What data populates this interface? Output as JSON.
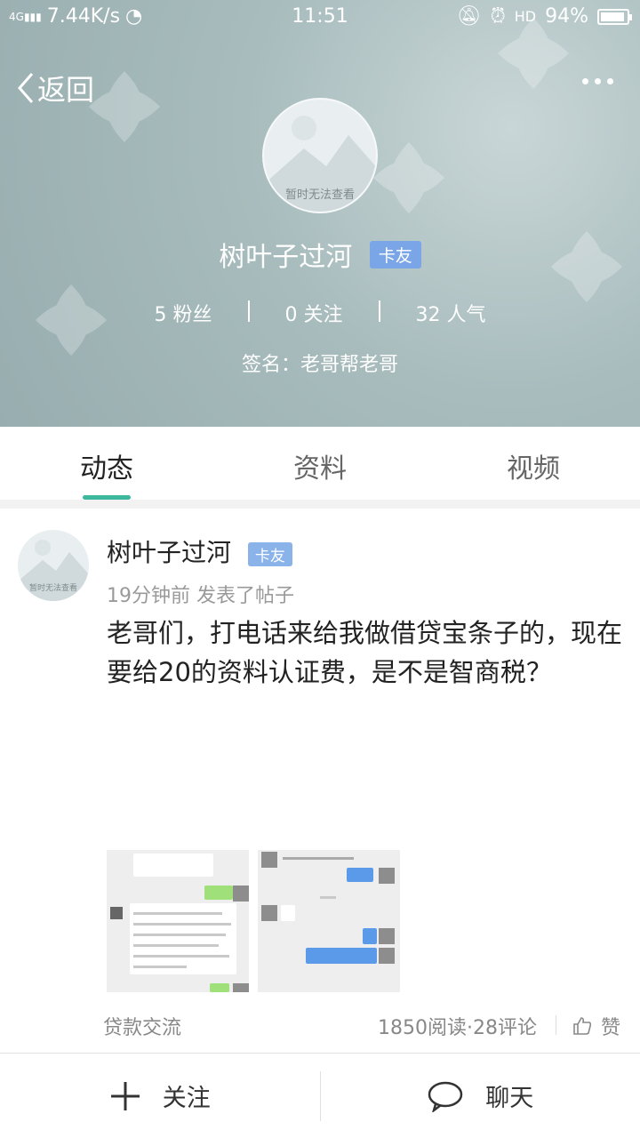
{
  "status_bar": {
    "network": "4G",
    "speed": "7.44K/s",
    "time": "11:51",
    "battery": "94%",
    "battery_level": 0.94
  },
  "header": {
    "back_label": "返回",
    "avatar_placeholder": "暂时无法查看",
    "name": "树叶子过河",
    "badge": "卡友",
    "stats": {
      "fans": "5 粉丝",
      "following": "0 关注",
      "popularity": "32 人气"
    },
    "signature": "签名：老哥帮老哥"
  },
  "tabs": [
    {
      "label": "动态",
      "active": true
    },
    {
      "label": "资料",
      "active": false
    },
    {
      "label": "视频",
      "active": false
    }
  ],
  "post": {
    "author": "树叶子过河",
    "badge": "卡友",
    "avatar_placeholder": "暂时无法查看",
    "meta": "19分钟前  发表了帖子",
    "text": "老哥们，打电话来给我做借贷宝条子的，现在要给20的资料认证费，是不是智商税？",
    "tag": "贷款交流",
    "reads": "1850阅读·28评论",
    "like_label": "赞"
  },
  "bottom_bar": {
    "follow_label": "关注",
    "chat_label": "聊天"
  },
  "colors": {
    "accent": "#3cb89c",
    "badge": "#7aa5e6",
    "hero_bg": "#a8bcbd"
  }
}
